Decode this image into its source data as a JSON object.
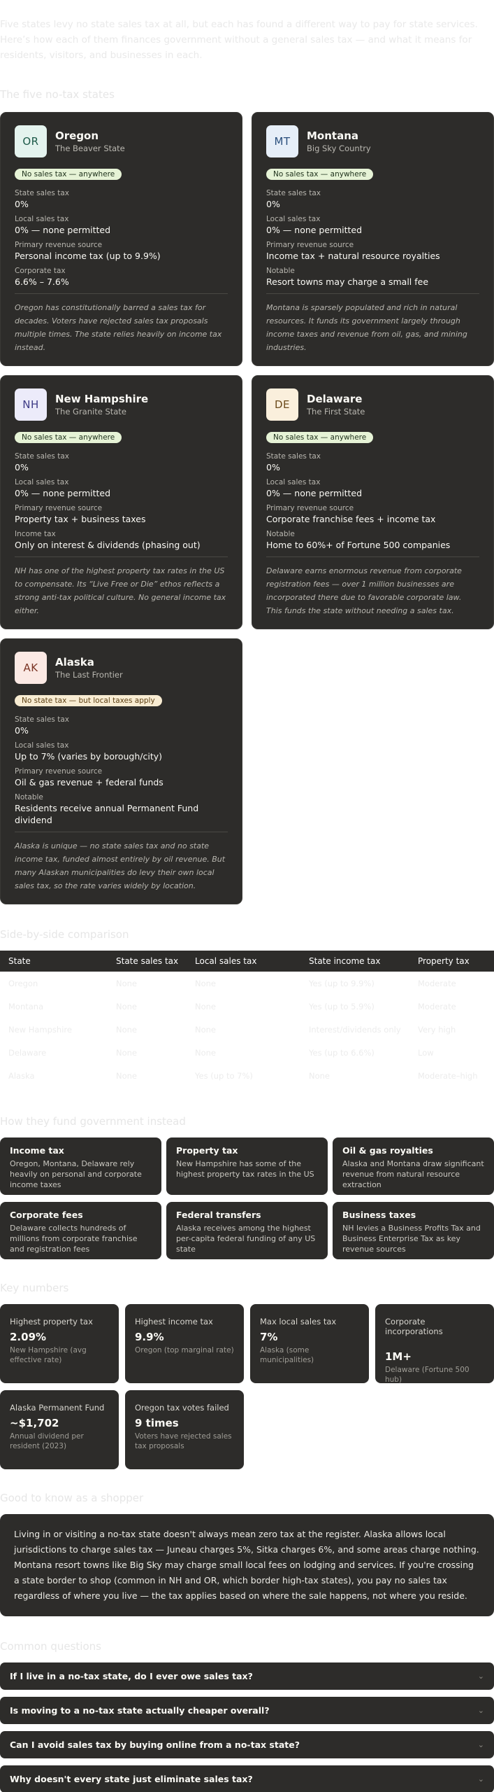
{
  "intro": {
    "text": "Five states levy no state sales tax at all, but each has found a different way to pay for state services. Here’s how each of them finances government without a general sales tax — and what it means for residents, visitors, and businesses in each."
  },
  "profiles_title": "The five no-tax states",
  "states": [
    {
      "abbr": "OR",
      "name": "Oregon",
      "nickname": "The Beaver State",
      "badge": "No sales tax — anywhere",
      "badge_color": "#e6f3d6",
      "abbr_bg": "#e4f3ee",
      "abbr_fg": "#1d5a49",
      "fields": [
        {
          "label": "State sales tax",
          "value": "0%"
        },
        {
          "label": "Local sales tax",
          "value": "0% — none permitted"
        },
        {
          "label": "Primary revenue source",
          "value": "Personal income tax (up to 9.9%)"
        },
        {
          "label": "Corporate tax",
          "value": "6.6% – 7.6%"
        }
      ],
      "note": "Oregon has constitutionally barred a sales tax for decades. Voters have rejected sales tax proposals multiple times. The state relies heavily on income tax instead."
    },
    {
      "abbr": "MT",
      "name": "Montana",
      "nickname": "Big Sky Country",
      "badge": "No sales tax — anywhere",
      "badge_color": "#e6f3d6",
      "abbr_bg": "#e6eef8",
      "abbr_fg": "#2a4f7c",
      "fields": [
        {
          "label": "State sales tax",
          "value": "0%"
        },
        {
          "label": "Local sales tax",
          "value": "0% — none permitted"
        },
        {
          "label": "Primary revenue source",
          "value": "Income tax + natural resource royalties"
        },
        {
          "label": "Notable",
          "value": "Resort towns may charge a small fee"
        }
      ],
      "note": "Montana is sparsely populated and rich in natural resources. It funds its government largely through income taxes and revenue from oil, gas, and mining industries."
    },
    {
      "abbr": "NH",
      "name": "New Hampshire",
      "nickname": "The Granite State",
      "badge": "No sales tax — anywhere",
      "badge_color": "#e6f3d6",
      "abbr_bg": "#ecebfa",
      "abbr_fg": "#3e3b86",
      "fields": [
        {
          "label": "State sales tax",
          "value": "0%"
        },
        {
          "label": "Local sales tax",
          "value": "0% — none permitted"
        },
        {
          "label": "Primary revenue source",
          "value": "Property tax + business taxes"
        },
        {
          "label": "Income tax",
          "value": "Only on interest & dividends (phasing out)"
        }
      ],
      "note": "NH has one of the highest property tax rates in the US to compensate. Its “Live Free or Die” ethos reflects a strong anti-tax political culture. No general income tax either."
    },
    {
      "abbr": "DE",
      "name": "Delaware",
      "nickname": "The First State",
      "badge": "No sales tax — anywhere",
      "badge_color": "#e6f3d6",
      "abbr_bg": "#faefdc",
      "abbr_fg": "#6b4a1c",
      "fields": [
        {
          "label": "State sales tax",
          "value": "0%"
        },
        {
          "label": "Local sales tax",
          "value": "0% — none permitted"
        },
        {
          "label": "Primary revenue source",
          "value": "Corporate franchise fees + income tax"
        },
        {
          "label": "Notable",
          "value": "Home to 60%+ of Fortune 500 companies"
        }
      ],
      "note": "Delaware earns enormous revenue from corporate registration fees — over 1 million businesses are incorporated there due to favorable corporate law. This funds the state without needing a sales tax."
    },
    {
      "abbr": "AK",
      "name": "Alaska",
      "nickname": "The Last Frontier",
      "badge": "No state tax — but local taxes apply",
      "badge_color": "#f8ecd2",
      "abbr_bg": "#fbe9e4",
      "abbr_fg": "#7a3424",
      "fields": [
        {
          "label": "State sales tax",
          "value": "0%"
        },
        {
          "label": "Local sales tax",
          "value": "Up to 7% (varies by borough/city)"
        },
        {
          "label": "Primary revenue source",
          "value": "Oil & gas revenue + federal funds"
        },
        {
          "label": "Notable",
          "value": "Residents receive annual Permanent Fund dividend"
        }
      ],
      "note": "Alaska is unique — no state sales tax and no state income tax, funded almost entirely by oil revenue. But many Alaskan municipalities do levy their own local sales tax, so the rate varies widely by location."
    }
  ],
  "comparison": {
    "title": "Side-by-side comparison",
    "headers": [
      "State",
      "State sales tax",
      "Local sales tax",
      "State income tax",
      "Property tax"
    ],
    "rows": [
      [
        "Oregon",
        "None",
        "None",
        "Yes (up to 9.9%)",
        "Moderate"
      ],
      [
        "Montana",
        "None",
        "None",
        "Yes (up to 5.9%)",
        "Moderate"
      ],
      [
        "New Hampshire",
        "None",
        "None",
        "Interest/dividends only",
        "Very high"
      ],
      [
        "Delaware",
        "None",
        "None",
        "Yes (up to 6.6%)",
        "Low"
      ],
      [
        "Alaska",
        "None",
        "Yes (up to 7%)",
        "None",
        "Moderate–high"
      ]
    ]
  },
  "revenue": {
    "title": "How they fund government instead",
    "tiles": [
      {
        "title": "Income tax",
        "desc": "Oregon, Montana, Delaware rely heavily on personal and corporate income taxes"
      },
      {
        "title": "Property tax",
        "desc": "New Hampshire has some of the highest property tax rates in the US"
      },
      {
        "title": "Oil & gas royalties",
        "desc": "Alaska and Montana draw significant revenue from natural resource extraction"
      },
      {
        "title": "Corporate fees",
        "desc": "Delaware collects hundreds of millions from corporate franchise and registration fees"
      },
      {
        "title": "Federal transfers",
        "desc": "Alaska receives among the highest per-capita federal funding of any US state"
      },
      {
        "title": "Business taxes",
        "desc": "NH levies a Business Profits Tax and Business Enterprise Tax as key revenue sources"
      }
    ]
  },
  "stats": {
    "title": "Key numbers",
    "items": [
      {
        "label": "Highest property tax",
        "value": "2.09%",
        "sub": "New Hampshire (avg effective rate)"
      },
      {
        "label": "Highest income tax",
        "value": "9.9%",
        "sub": "Oregon (top marginal rate)"
      },
      {
        "label": "Max local sales tax",
        "value": "7%",
        "sub": "Alaska (some municipalities)"
      },
      {
        "label": "Corporate incorporations",
        "value": "1M+",
        "sub": "Delaware (Fortune 500 hub)"
      },
      {
        "label": "Alaska Permanent Fund",
        "value": "~$1,702",
        "sub": "Annual dividend per resident (2023)"
      },
      {
        "label": "Oregon tax votes failed",
        "value": "9 times",
        "sub": "Voters have rejected sales tax proposals"
      }
    ]
  },
  "notice": {
    "title": "Good to know as a shopper",
    "text": "Living in or visiting a no-tax state doesn't always mean zero tax at the register. Alaska allows local jurisdictions to charge sales tax — Juneau charges 5%, Sitka charges 6%, and some areas charge nothing. Montana resort towns like Big Sky may charge small local fees on lodging and services. If you're crossing a state border to shop (common in NH and OR, which border high-tax states), you pay no sales tax regardless of where you live — the tax applies based on where the sale happens, not where you reside."
  },
  "faq": {
    "title": "Common questions",
    "items": [
      "If I live in a no-tax state, do I ever owe sales tax?",
      "Is moving to a no-tax state actually cheaper overall?",
      "Can I avoid sales tax by buying online from a no-tax state?",
      "Why doesn't every state just eliminate sales tax?"
    ]
  }
}
